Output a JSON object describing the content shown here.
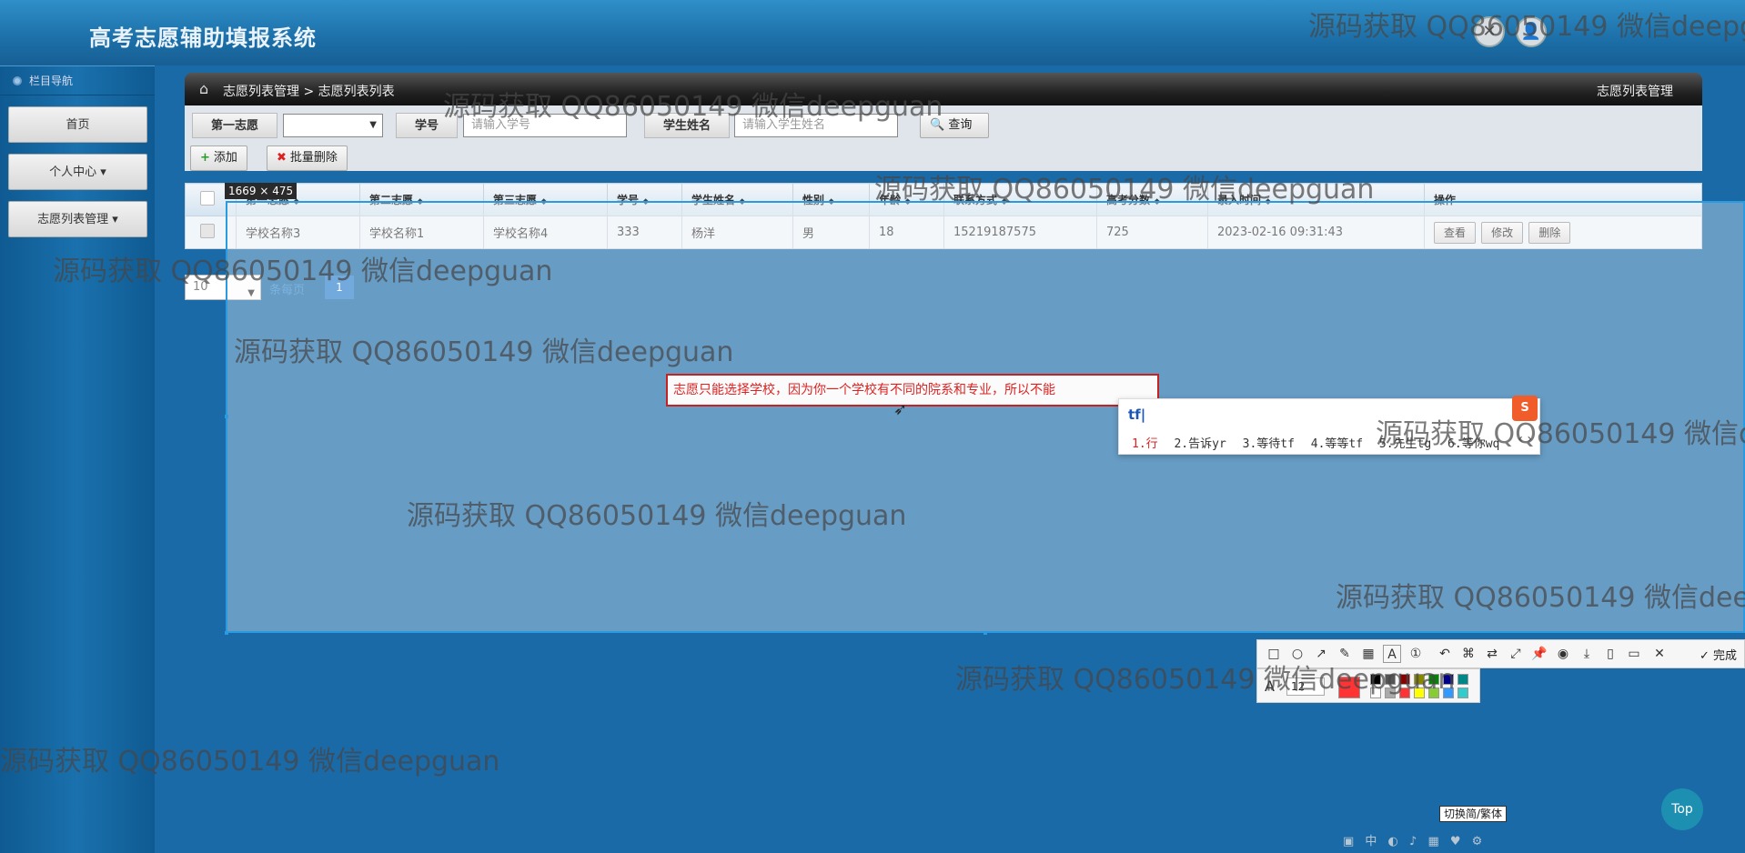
{
  "app": {
    "title": "高考志愿辅助填报系统"
  },
  "header_icons": {
    "close": "✕",
    "user": "👤"
  },
  "sidebar": {
    "heading": "栏目导航",
    "items": [
      {
        "label": "首页"
      },
      {
        "label": "个人中心 ▾"
      },
      {
        "label": "志愿列表管理 ▾"
      }
    ]
  },
  "breadcrumb": {
    "path": "志愿列表管理 > 志愿列表列表",
    "right": "志愿列表管理"
  },
  "search": {
    "choice_label": "第一志愿",
    "choice_value": "",
    "student_no_label": "学号",
    "student_no_placeholder": "请输入学号",
    "student_name_label": "学生姓名",
    "student_name_placeholder": "请输入学生姓名",
    "query_button": "🔍 查询"
  },
  "actions": {
    "add": "添加",
    "batch_delete": "批量删除"
  },
  "table": {
    "columns": [
      "第一志愿",
      "第二志愿",
      "第三志愿",
      "学号",
      "学生姓名",
      "性别",
      "年龄",
      "联系方式",
      "高考分数",
      "录入时间",
      "操作"
    ],
    "rows": [
      {
        "cells": [
          "学校名称3",
          "学校名称1",
          "学校名称4",
          "333",
          "杨洋",
          "男",
          "18",
          "15219187575",
          "725",
          "2023-02-16 09:31:43"
        ],
        "ops": [
          "查看",
          "修改",
          "删除"
        ]
      }
    ]
  },
  "pagination": {
    "page_size": "10",
    "per_page_label": "条每页",
    "current_page": "1"
  },
  "capture": {
    "size_label": "1669 × 475",
    "note_text": "志愿只能选择学校，因为你一个学校有不同的院系和专业，所以不能"
  },
  "ime": {
    "input": "tf|",
    "candidates": [
      "1.行",
      "2.告诉yr",
      "3.等待tf",
      "4.等等tf",
      "5.先生tg",
      "6.等你wq"
    ],
    "nav": "‹ ›"
  },
  "toolbar": {
    "done_label": "完成",
    "font_size": "12"
  },
  "widgets": {
    "ime_toggle": "切换简/繁体",
    "top_button": "Top"
  },
  "watermark": {
    "text": "源码获取 QQ86050149 微信deepguan"
  },
  "colors": {
    "header": "#1c6fa8",
    "sidebar": "#1a71ad",
    "accent": "#2a80d0",
    "note_border": "#c92020"
  }
}
